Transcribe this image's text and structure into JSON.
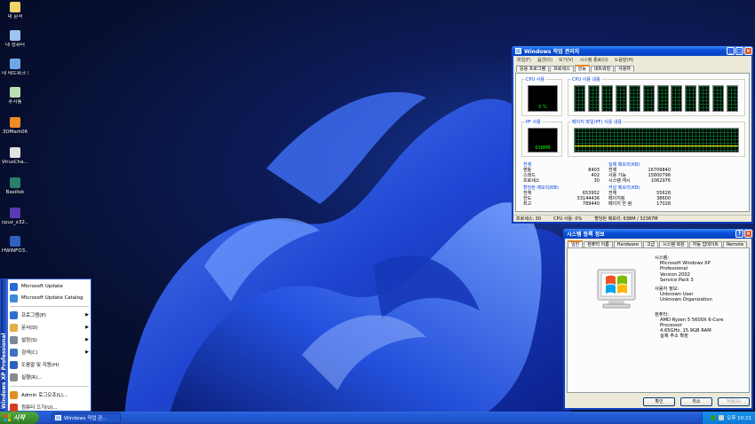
{
  "desktop": {
    "icons": [
      {
        "label": "내 문서",
        "color": "#f2d16b"
      },
      {
        "label": "내 컴퓨터",
        "color": "#9ec5f0"
      },
      {
        "label": "내 네트워크 환경",
        "color": "#6fa6e8"
      },
      {
        "label": "휴지통",
        "color": "#b9e0b0"
      },
      {
        "label": "3DMark06",
        "color": "#f08a24"
      },
      {
        "label": "VirusCha...",
        "color": "#e0e0e0"
      },
      {
        "label": "Basilisk",
        "color": "#2a7f6a"
      },
      {
        "label": "cpuz_x32....",
        "color": "#5a3ab0"
      },
      {
        "label": "HWiNFO3...",
        "color": "#3060c0"
      }
    ]
  },
  "taskmgr": {
    "title": "Windows 작업 관리자",
    "menu": [
      "파일(F)",
      "옵션(O)",
      "보기(V)",
      "시스템 종료(U)",
      "도움말(H)"
    ],
    "tabs": [
      "응용 프로그램",
      "프로세스",
      "성능",
      "네트워킹",
      "사용자"
    ],
    "active_tab": "성능",
    "cpu_usage_label": "CPU 사용",
    "cpu_usage_value": "0 %",
    "cpu_history_label": "CPU 사용 내용",
    "pf_usage_label": "PF 사용",
    "pf_usage_value": "638MB",
    "pf_history_label": "페이지 파일(PF) 사용 내용",
    "totals": {
      "heading": "전체",
      "rows": [
        [
          "핸들",
          "8403"
        ],
        [
          "스레드",
          "402"
        ],
        [
          "프로세스",
          "30"
        ]
      ]
    },
    "physical": {
      "heading": "실제 메모리(KB)",
      "rows": [
        [
          "전체",
          "16709840"
        ],
        [
          "사용 가능",
          "15800796"
        ],
        [
          "시스템 캐시",
          "1062976"
        ]
      ]
    },
    "commit": {
      "heading": "할당된 메모리(KB)",
      "rows": [
        [
          "전체",
          "653952"
        ],
        [
          "한도",
          "33144436"
        ],
        [
          "최고",
          "789440"
        ]
      ]
    },
    "kernel": {
      "heading": "커널 메모리(KB)",
      "rows": [
        [
          "전체",
          "55628"
        ],
        [
          "페이지됨",
          "38600"
        ],
        [
          "페이지 안 됨",
          "17028"
        ]
      ]
    },
    "status": [
      "프로세스: 30",
      "CPU 사용: 0%",
      "할당된 메모리: 638M / 32367M"
    ]
  },
  "sysprops": {
    "title": "시스템 등록 정보",
    "tabs": [
      "일반",
      "컴퓨터 이름",
      "Hardware",
      "고급",
      "시스템 복원",
      "자동 업데이트",
      "Remote"
    ],
    "active_tab": "일반",
    "system_heading": "시스템:",
    "system_lines": [
      "Microsoft Windows XP",
      "Professional",
      "Version 2002",
      "Service Pack 3"
    ],
    "user_heading": "사용자 정보:",
    "user_lines": [
      "Unknown User",
      "Unknown Organization"
    ],
    "computer_heading": "컴퓨터:",
    "computer_lines": [
      "AMD Ryzen 5 5600X 6-Core",
      "Processor",
      "4.65GHz, 15.9GB RAM",
      "실제 주소 확장"
    ],
    "buttons": {
      "ok": "확인",
      "cancel": "취소",
      "apply": "적용(A)"
    }
  },
  "startmenu": {
    "band_text": "Windows XP Professional",
    "top_items": [
      {
        "label": "Microsoft Update",
        "color": "#2a6ad8"
      },
      {
        "label": "Microsoft Update Catalog",
        "color": "#3a8ad8"
      }
    ],
    "items": [
      {
        "label": "프로그램(P)",
        "color": "#2c6fd0",
        "arrow": "▶"
      },
      {
        "label": "문서(D)",
        "color": "#e0b040",
        "arrow": "▶"
      },
      {
        "label": "설정(S)",
        "color": "#7a8a9a",
        "arrow": "▶"
      },
      {
        "label": "검색(C)",
        "color": "#4070c0",
        "arrow": "▶"
      },
      {
        "label": "도움말 및 지원(H)",
        "color": "#2a60c0",
        "arrow": ""
      },
      {
        "label": "실행(R)...",
        "color": "#8a8a8a",
        "arrow": ""
      }
    ],
    "bottom_items": [
      {
        "label": "Admin 로그오프(L)...",
        "color": "#e09020"
      },
      {
        "label": "컴퓨터 끄기(U)...",
        "color": "#d04020"
      }
    ]
  },
  "taskbar": {
    "start_label": "시작",
    "task_label": "Windows 작업 관...",
    "clock": "오후 10:21"
  }
}
